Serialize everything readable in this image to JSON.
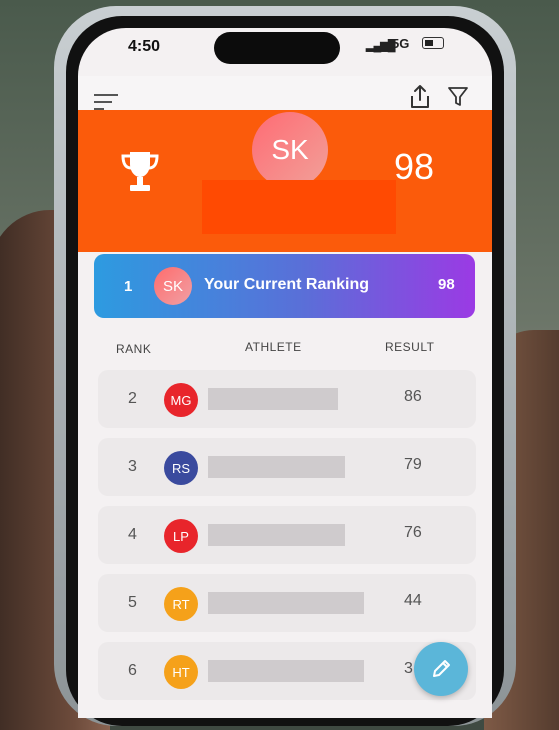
{
  "status_bar": {
    "time": "4:50",
    "network": "5G"
  },
  "hero": {
    "initials": "SK",
    "score": "98"
  },
  "current_ranking": {
    "rank": "1",
    "initials": "SK",
    "label": "Your Current Ranking",
    "score": "98"
  },
  "columns": {
    "rank": "RANK",
    "athlete": "ATHLETE",
    "result": "RESULT"
  },
  "rows": [
    {
      "rank": "2",
      "initials": "MG",
      "result": "86",
      "color": "#e8252b"
    },
    {
      "rank": "3",
      "initials": "RS",
      "result": "79",
      "color": "#3a4a9e"
    },
    {
      "rank": "4",
      "initials": "LP",
      "result": "76",
      "color": "#e8252b"
    },
    {
      "rank": "5",
      "initials": "RT",
      "result": "44",
      "color": "#f5a11a"
    },
    {
      "rank": "6",
      "initials": "HT",
      "result": "3",
      "color": "#f5a11a"
    }
  ],
  "icons": {
    "menu": "menu-icon",
    "share": "share-icon",
    "filter": "filter-icon",
    "trophy": "trophy-icon",
    "edit": "pencil-icon"
  },
  "colors": {
    "hero": "#fb5b0b",
    "banner_start": "#2d9be0",
    "banner_end": "#9b3ae4",
    "fab": "#5bb6d9"
  }
}
